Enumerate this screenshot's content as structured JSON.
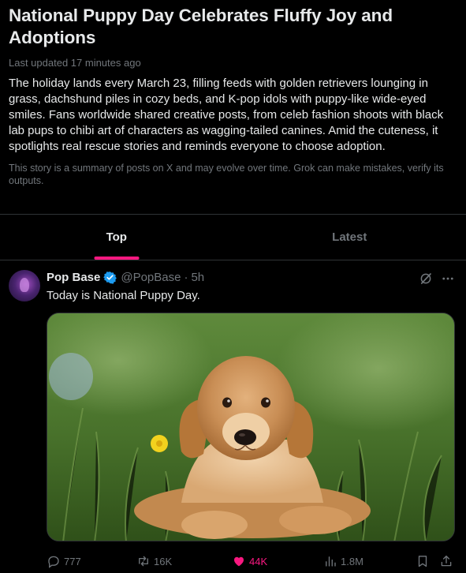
{
  "story": {
    "title": "National Puppy Day Celebrates Fluffy Joy and Adoptions",
    "updated": "Last updated 17 minutes ago",
    "summary": "The holiday lands every March 23, filling feeds with golden retrievers lounging in grass, dachshund piles in cozy beds, and K-pop idols with puppy-like wide-eyed smiles. Fans worldwide shared creative posts, from celeb fashion shoots with black lab pups to chibi art of characters as wagging-tailed canines. Amid the cuteness, it spotlights real rescue stories and reminds everyone to choose adoption.",
    "disclaimer": "This story is a summary of posts on X and may evolve over time. Grok can make mistakes, verify its outputs."
  },
  "tabs": [
    {
      "label": "Top",
      "active": true
    },
    {
      "label": "Latest",
      "active": false
    }
  ],
  "post": {
    "author": "Pop Base",
    "handle": "@PopBase",
    "separator": "·",
    "time": "5h",
    "text": "Today is National Puppy Day.",
    "media_description_icon": "puppy-photo",
    "stats": {
      "replies": "777",
      "reposts": "16K",
      "likes": "44K",
      "views": "1.8M"
    }
  },
  "colors": {
    "background": "#000000",
    "text": "#e7e9ea",
    "muted": "#71767b",
    "accent": "#f91880",
    "verified": "#1d9bf0",
    "border": "#2f3336"
  },
  "icons": [
    "verified-badge-icon",
    "grok-icon",
    "more-icon",
    "reply-icon",
    "repost-icon",
    "like-icon",
    "views-icon",
    "bookmark-icon",
    "share-icon"
  ]
}
